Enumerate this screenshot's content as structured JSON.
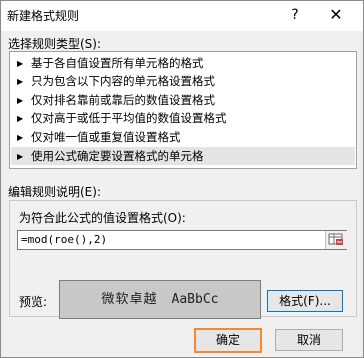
{
  "dialog": {
    "title": "新建格式规则",
    "help_label": "?",
    "close_label": "✕"
  },
  "rule_type": {
    "label": "选择规则类型(S):",
    "items": [
      {
        "label": "基于各自值设置所有单元格的格式"
      },
      {
        "label": "只为包含以下内容的单元格设置格式"
      },
      {
        "label": "仅对排名靠前或靠后的数值设置格式"
      },
      {
        "label": "仅对高于或低于平均值的数值设置格式"
      },
      {
        "label": "仅对唯一值或重复值设置格式"
      },
      {
        "label": "使用公式确定要设置格式的单元格",
        "selected": true
      }
    ]
  },
  "rule_description": {
    "label": "编辑规则说明(E):",
    "formula_label": "为符合此公式的值设置格式(O):",
    "formula_value": "=mod(roe(),2)"
  },
  "preview": {
    "label": "预览:",
    "sample_cjk": "微软卓越",
    "sample_latin": "AaBbCc"
  },
  "buttons": {
    "format": "格式(F)...",
    "ok": "确定",
    "cancel": "取消"
  },
  "colors": {
    "ok_highlight": "#f28a30",
    "preview_bg": "#c8c8c8",
    "selected_row": "#e4e4e4"
  }
}
